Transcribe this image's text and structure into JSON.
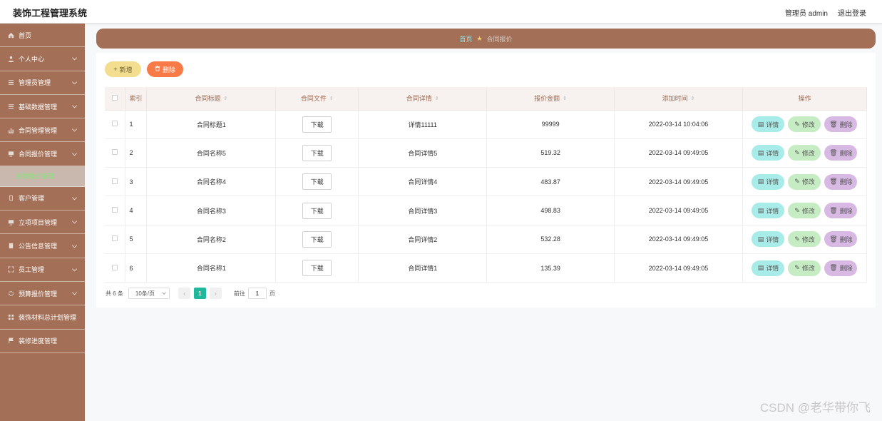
{
  "header": {
    "title": "装饰工程管理系统",
    "user_label": "管理员 admin",
    "logout_label": "退出登录"
  },
  "sidebar": {
    "items": [
      {
        "label": "首页",
        "icon": "home-icon",
        "has_children": false
      },
      {
        "label": "个人中心",
        "icon": "user-icon",
        "has_children": true
      },
      {
        "label": "管理员管理",
        "icon": "list-icon",
        "has_children": true
      },
      {
        "label": "基础数据管理",
        "icon": "list-icon",
        "has_children": true
      },
      {
        "label": "合同管理管理",
        "icon": "chart-icon",
        "has_children": true
      },
      {
        "label": "合同报价管理",
        "icon": "monitor-icon",
        "has_children": true
      },
      {
        "label": "客户管理",
        "icon": "mobile-icon",
        "has_children": true
      },
      {
        "label": "立项项目管理",
        "icon": "monitor-icon",
        "has_children": true
      },
      {
        "label": "公告信息管理",
        "icon": "document-icon",
        "has_children": true
      },
      {
        "label": "员工管理",
        "icon": "expand-icon",
        "has_children": true
      },
      {
        "label": "预算报价管理",
        "icon": "gear-icon",
        "has_children": true
      },
      {
        "label": "装饰材料总计划管理",
        "icon": "grid-icon",
        "has_children": false
      },
      {
        "label": "装修进度管理",
        "icon": "flag-icon",
        "has_children": false
      }
    ],
    "active_sub_label": "合同报价管理"
  },
  "breadcrumb": {
    "home": "首页",
    "current": "合同报价"
  },
  "toolbar": {
    "add_label": "新增",
    "delete_label": "删除"
  },
  "table": {
    "headers": {
      "index": "索引",
      "title": "合同标题",
      "file": "合同文件",
      "detail": "合同详情",
      "amount": "报价金额",
      "time": "添加时间",
      "ops": "操作"
    },
    "download_label": "下载",
    "op_labels": {
      "detail": "详情",
      "edit": "修改",
      "delete": "删除"
    },
    "rows": [
      {
        "index": "1",
        "title": "合同标题1",
        "detail": "详情11111",
        "amount": "99999",
        "time": "2022-03-14 10:04:06"
      },
      {
        "index": "2",
        "title": "合同名称5",
        "detail": "合同详情5",
        "amount": "519.32",
        "time": "2022-03-14 09:49:05"
      },
      {
        "index": "3",
        "title": "合同名称4",
        "detail": "合同详情4",
        "amount": "483.87",
        "time": "2022-03-14 09:49:05"
      },
      {
        "index": "4",
        "title": "合同名称3",
        "detail": "合同详情3",
        "amount": "498.83",
        "time": "2022-03-14 09:49:05"
      },
      {
        "index": "5",
        "title": "合同名称2",
        "detail": "合同详情2",
        "amount": "532.28",
        "time": "2022-03-14 09:49:05"
      },
      {
        "index": "6",
        "title": "合同名称1",
        "detail": "合同详情1",
        "amount": "135.39",
        "time": "2022-03-14 09:49:05"
      }
    ]
  },
  "pagination": {
    "total_label": "共 6 条",
    "page_size_label": "10条/页",
    "current_page": "1",
    "goto_label": "前往",
    "goto_value": "1",
    "page_unit": "页"
  },
  "watermark": "CSDN @老华带你飞",
  "colors": {
    "sidebar_bg": "#a36f56",
    "accent_teal": "#1fb89d",
    "add_button": "#f3dd8e",
    "delete_button": "#f77a47"
  }
}
